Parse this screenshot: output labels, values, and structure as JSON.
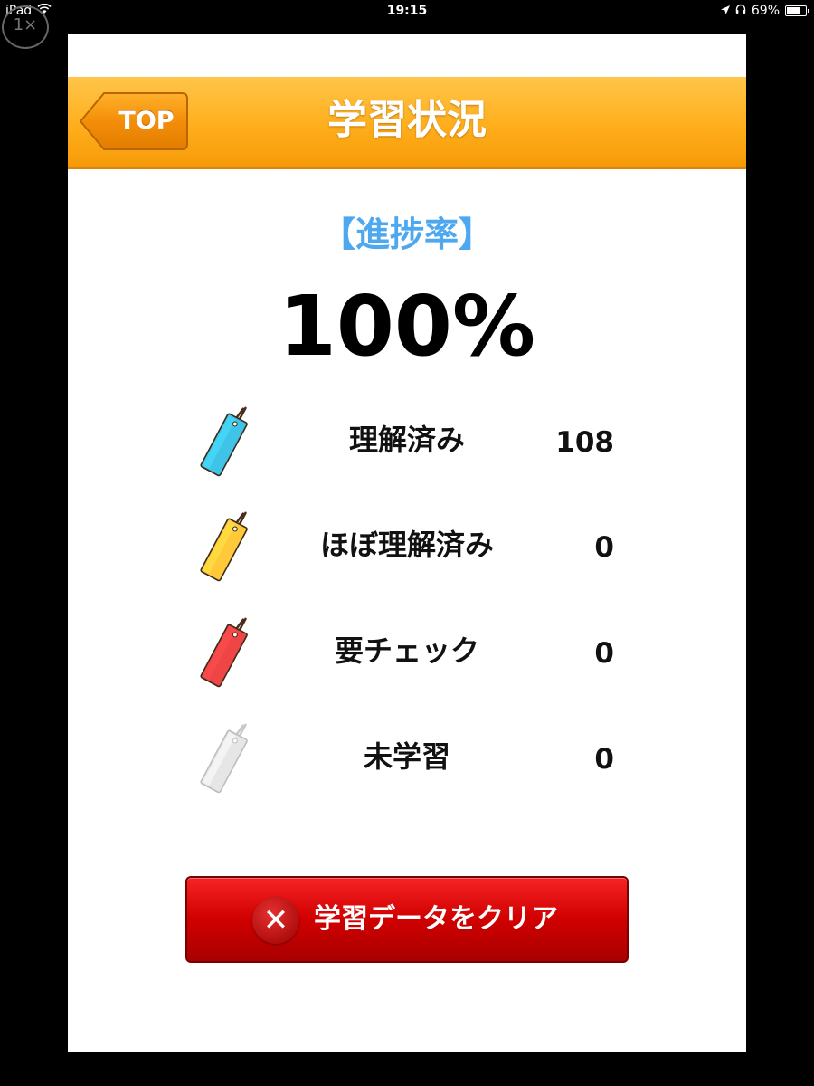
{
  "status_bar": {
    "device": "iPad",
    "time": "19:15",
    "battery": "69%",
    "battery_level": 0.69,
    "zoom_label": "1×"
  },
  "header": {
    "back_label": "TOP",
    "title": "学習状況"
  },
  "progress": {
    "label": "【進捗率】",
    "value": "100%"
  },
  "rows": [
    {
      "label": "理解済み",
      "count": "108",
      "tag_color": "#3fc4e8",
      "icon": "blue-tag-icon"
    },
    {
      "label": "ほぼ理解済み",
      "count": "0",
      "tag_color": "#ffc93a",
      "icon": "yellow-tag-icon"
    },
    {
      "label": "要チェック",
      "count": "0",
      "tag_color": "#f04545",
      "icon": "red-tag-icon"
    },
    {
      "label": "未学習",
      "count": "0",
      "tag_color": "#e6e6e6",
      "icon": "gray-tag-icon"
    }
  ],
  "clear_button": {
    "label": "学習データをクリア",
    "icon": "close-icon"
  },
  "colors": {
    "header": "#ffae1c",
    "progress_label": "#4ea8f0",
    "clear_button": "#d00000"
  }
}
